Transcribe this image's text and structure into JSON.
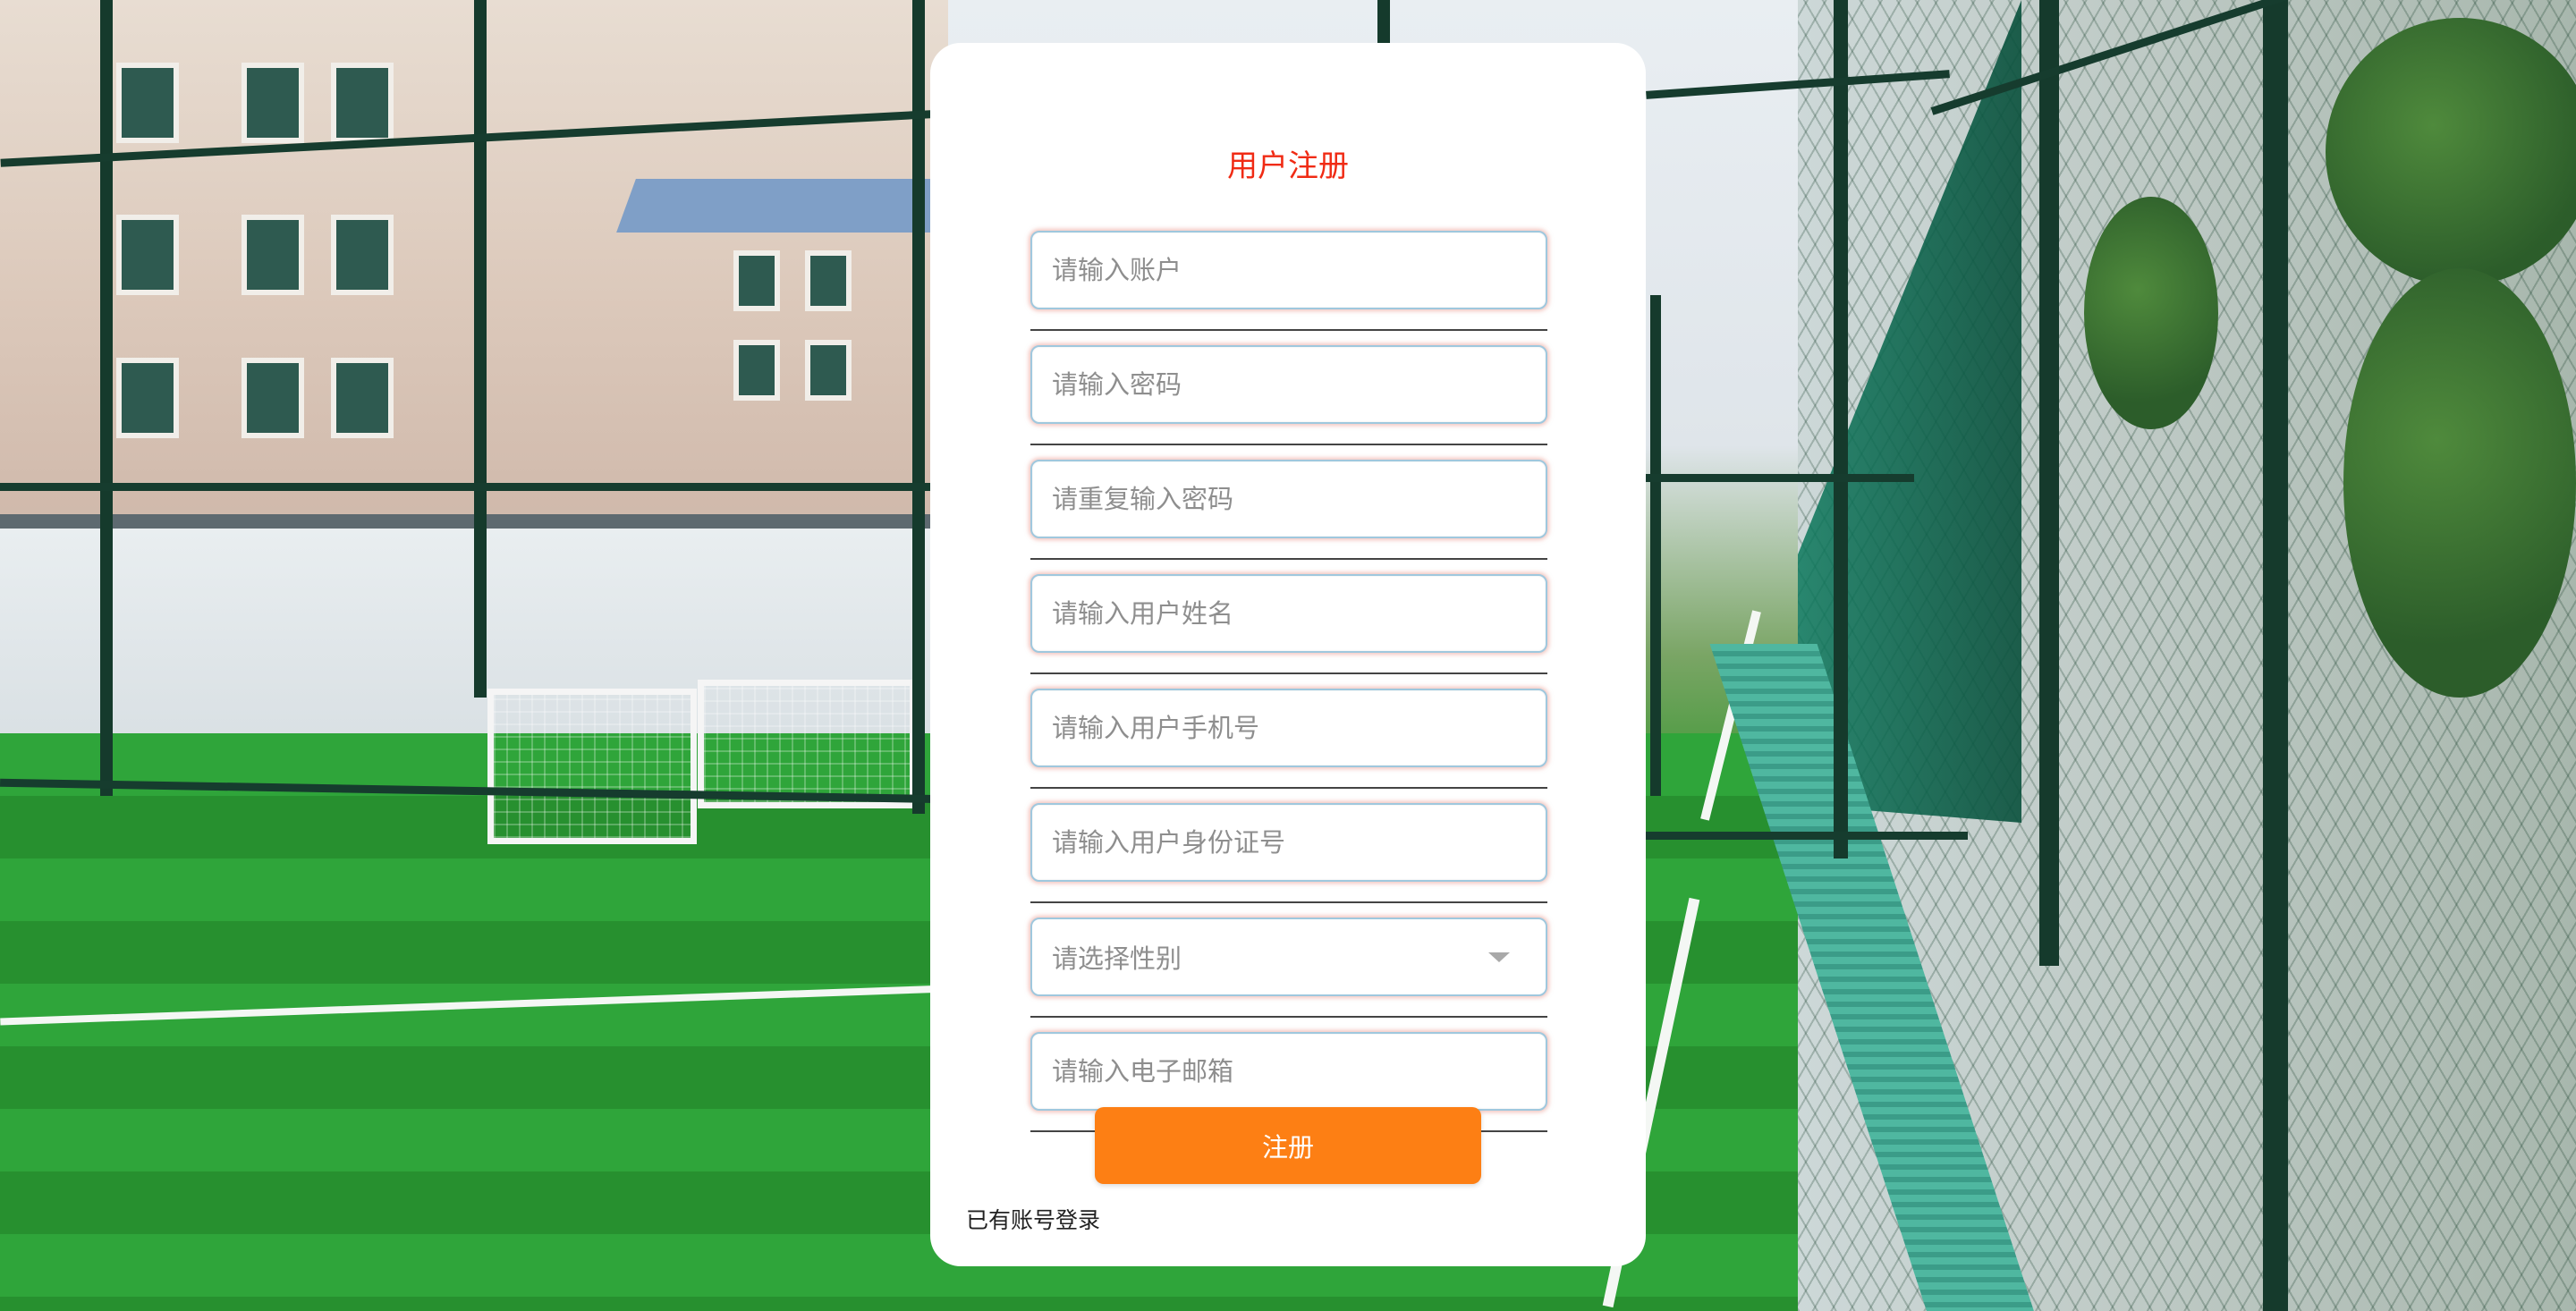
{
  "form": {
    "title": "用户注册",
    "fields": [
      {
        "name": "account",
        "placeholder": "请输入账户",
        "value": ""
      },
      {
        "name": "password",
        "placeholder": "请输入密码",
        "value": ""
      },
      {
        "name": "confirm_password",
        "placeholder": "请重复输入密码",
        "value": ""
      },
      {
        "name": "user_name",
        "placeholder": "请输入用户姓名",
        "value": ""
      },
      {
        "name": "phone",
        "placeholder": "请输入用户手机号",
        "value": ""
      },
      {
        "name": "id_number",
        "placeholder": "请输入用户身份证号",
        "value": ""
      },
      {
        "name": "gender",
        "placeholder": "请选择性别",
        "value": ""
      },
      {
        "name": "email",
        "placeholder": "请输入电子邮箱",
        "value": ""
      }
    ],
    "submit_label": "注册",
    "login_link": "已有账号登录"
  },
  "colors": {
    "title": "#f02b14",
    "button": "#fd7f14"
  },
  "icons": {
    "gender_dropdown": "chevron-down-icon"
  }
}
